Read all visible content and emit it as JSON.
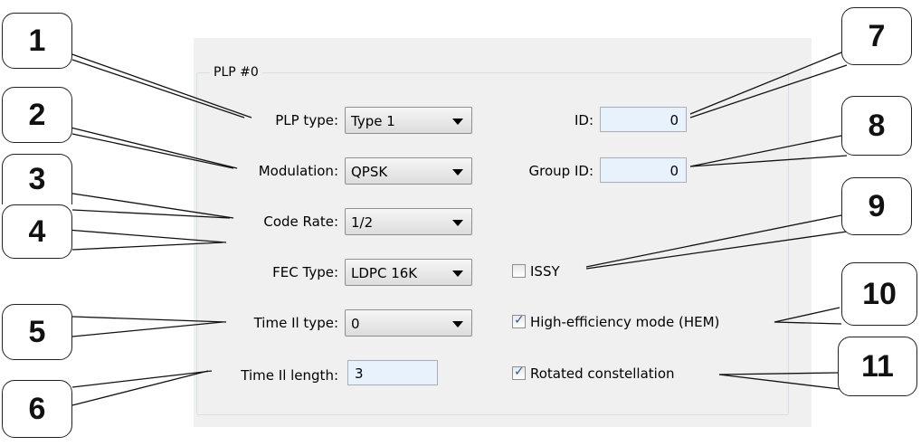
{
  "group": {
    "title": "PLP #0"
  },
  "fields": {
    "plp_type": {
      "label": "PLP type:",
      "value": "Type 1"
    },
    "modulation": {
      "label": "Modulation:",
      "value": "QPSK"
    },
    "code_rate": {
      "label": "Code Rate:",
      "value": "1/2"
    },
    "fec_type": {
      "label": "FEC Type:",
      "value": "LDPC 16K"
    },
    "time_il_type": {
      "label": "Time Il type:",
      "value": "0"
    },
    "time_il_length": {
      "label": "Time Il length:",
      "value": "3"
    },
    "id": {
      "label": "ID:",
      "value": "0"
    },
    "group_id": {
      "label": "Group ID:",
      "value": "0"
    }
  },
  "checkboxes": {
    "issy": {
      "label": "ISSY",
      "checked": false
    },
    "hem": {
      "label": "High-efficiency mode (HEM)",
      "checked": true
    },
    "rotated": {
      "label": "Rotated constellation",
      "checked": true
    }
  },
  "callouts": [
    "1",
    "2",
    "3",
    "4",
    "5",
    "6",
    "7",
    "8",
    "9",
    "10",
    "11"
  ]
}
